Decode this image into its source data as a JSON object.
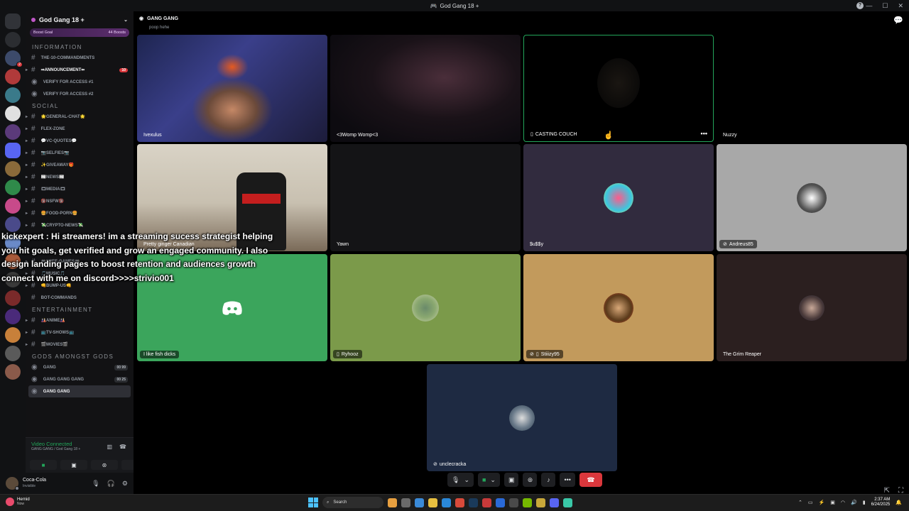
{
  "window": {
    "title": "God Gang 18 +"
  },
  "server": {
    "name": "God Gang 18 +",
    "boost_label": "Boost Goal",
    "boost_count": "44 Boosts"
  },
  "categories": {
    "information": "INFORMATION",
    "social": "SOCIAL",
    "entertainment": "ENTERTAINMENT",
    "gods": "GODS AMONGST GODS"
  },
  "channels_info": [
    {
      "label": "THE-10-COMMANDMENTS"
    },
    {
      "label": "⇛ANNOUNCEMENT⇚",
      "badge": "10"
    },
    {
      "label": "VERIFY FOR ACCESS #1"
    },
    {
      "label": "VERIFY FOR ACCESS #2"
    }
  ],
  "channels_social": [
    {
      "label": "🌟GENERAL-CHAT🌟"
    },
    {
      "label": "FLEX-ZONE"
    },
    {
      "label": "💬VC-QUOTES💬"
    },
    {
      "label": "📷SELFIES📷"
    },
    {
      "label": "✨GIVEAWAY🎁"
    },
    {
      "label": "📰NEWS📰"
    },
    {
      "label": "🎞MEDIA🎞"
    },
    {
      "label": "🔞NSFW🔞"
    },
    {
      "label": "🍔FOOD-PORN🍔"
    },
    {
      "label": "💸CRYPTO-NEWS💸"
    }
  ],
  "channels_misc": [
    {
      "label": "🎮FREE-GAMES🎮"
    },
    {
      "label": "🎵MUSIC🎵"
    },
    {
      "label": "👊BUMP-US👊"
    },
    {
      "label": "BOT-COMMANDS"
    }
  ],
  "channels_ent": [
    {
      "label": "🎎ANIME🎎"
    },
    {
      "label": "📺TV-SHOWS📺"
    },
    {
      "label": "🎬MOVIES🎬"
    }
  ],
  "channels_voice": [
    {
      "label": "GANG",
      "counter": "00 99"
    },
    {
      "label": "GANG GANG GANG",
      "counter": "00 25"
    },
    {
      "label": "GANG GANG"
    }
  ],
  "voice": {
    "status": "Video Connected",
    "location": "GANG GANG / God Gang 18 +"
  },
  "user": {
    "name": "Coca-Cola",
    "status": "Invisible"
  },
  "stage": {
    "channel": "GANG GANG",
    "topic": "poop hehe"
  },
  "tiles": [
    {
      "name": "Ivexulus"
    },
    {
      "name": "<3Womp Womp<3"
    },
    {
      "name": "CASTING COUCH"
    },
    {
      "name": "Nuzzy"
    },
    {
      "name": "Pretty ginger Canadian"
    },
    {
      "name": "Yawn"
    },
    {
      "name": "$u$$y"
    },
    {
      "name": "Andreus85"
    },
    {
      "name": "I like fish dicks"
    },
    {
      "name": "Ryhooz"
    },
    {
      "name": "Stiiizy95"
    },
    {
      "name": "The Grim Reaper"
    },
    {
      "name": "unclecracka"
    }
  ],
  "chat_overlay": [
    "kickexpert : Hi streamers! im a streaming sucess strategist helping",
    "you hit goals, get verified and grow an engaged community. I also",
    "design landing pages to boost retention and audiences growth",
    "connect with me on discord>>>>strivio001"
  ],
  "taskbar": {
    "weather_title": "Hernid",
    "weather_sub": "Now",
    "search": "Search",
    "time": "2:37 AM",
    "date": "6/24/2025"
  },
  "colors": {
    "green": "#23a55a",
    "red": "#da373c",
    "blurple": "#5865f2"
  }
}
